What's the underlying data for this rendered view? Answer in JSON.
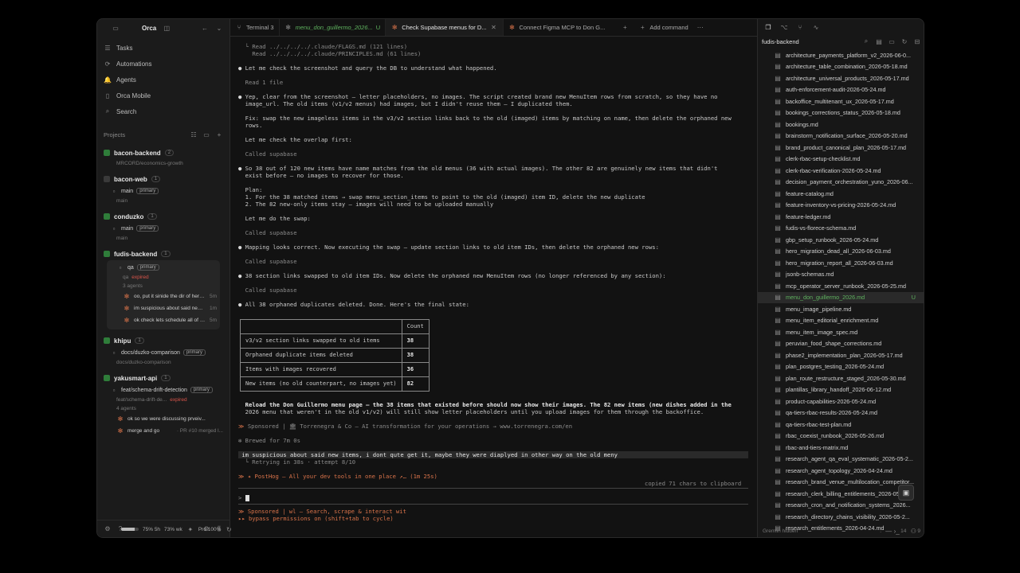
{
  "app": {
    "name": "Orca"
  },
  "nav": [
    {
      "label": "Tasks",
      "icon": "tasks-icon",
      "glyph": "☰"
    },
    {
      "label": "Automations",
      "icon": "automations-icon",
      "glyph": "⟳"
    },
    {
      "label": "Agents",
      "icon": "agents-icon",
      "glyph": "🔔"
    },
    {
      "label": "Orca Mobile",
      "icon": "mobile-icon",
      "glyph": "▯"
    },
    {
      "label": "Search",
      "icon": "search-icon",
      "glyph": "⌕"
    }
  ],
  "projects_label": "Projects",
  "projects": [
    {
      "name": "bacon-backend",
      "count": "2",
      "sub": "economics-growth",
      "path": "MRCORD/economics-growth"
    },
    {
      "name": "bacon-web",
      "count": "1",
      "branch": "main",
      "badge": "primary",
      "sub": "main"
    },
    {
      "name": "conduzko",
      "count": "1",
      "branch": "main",
      "badge": "primary",
      "sub": "main"
    },
    {
      "name": "fudis-backend",
      "count": "1",
      "branch": "qa",
      "badge": "primary",
      "sub": "qa",
      "status": "expired",
      "agents_label": "3 agents",
      "agents": [
        {
          "text": "oo, put it sinide the dir of here f...",
          "time": "5m"
        },
        {
          "text": "im suspicious about said new it...",
          "time": "1m"
        },
        {
          "text": "ok check lets schedule all of e...",
          "time": "5m"
        }
      ]
    },
    {
      "name": "khipu",
      "count": "1",
      "branch": "docs/duzko-comparison",
      "badge": "primary",
      "sub": "docs/duzko-comparison"
    },
    {
      "name": "yakusmart-api",
      "count": "1",
      "branch": "feat/schema-drift-detection",
      "badge": "primary",
      "sub": "feat/schema-drift-de...",
      "status": "expired",
      "agents_label": "4 agents",
      "agents": [
        {
          "text": "ok so we were discussing prveiv...",
          "time": ""
        },
        {
          "text": "merge and go",
          "time": "· PR #10 merged l..."
        }
      ]
    }
  ],
  "usage": {
    "five_hour": "75% 5h",
    "week": "73% wk",
    "plan": "Pro 100%",
    "five_hour_fraction": 0.75
  },
  "tabs": [
    {
      "label": "Terminal 3",
      "active": false
    },
    {
      "label": "menu_don_guillermo_2026...",
      "active": false,
      "suffix": "U"
    },
    {
      "label": "Check Supabase menus for D...",
      "active": true
    },
    {
      "label": "Connect Figma MCP to Don G...",
      "active": false
    },
    {
      "label": "Add command",
      "active": false
    }
  ],
  "terminal": {
    "read1": "Read ../../../../.claude/FLAGS.md (121 lines)",
    "read2": "Read ../../../../.claude/PRINCIPLES.md (61 lines)",
    "l1": "Let me check the screenshot and query the DB to understand what happened.",
    "l2": "Read 1 file",
    "p1a": "Yep, clear from the screenshot — letter placeholders, no images. The script created brand new MenuItem rows from scratch, so they have no",
    "p1b": "image_url. The old items (v1/v2 menus) had images, but I didn't reuse them — I duplicated them.",
    "fix1": "Fix: swap the new imageless items in the v3/v2 section links back to the old (imaged) items by matching on name, then delete the orphaned new",
    "fix2": "rows.",
    "l3": "Let me check the overlap first:",
    "called": "Called supabase",
    "p2a": "So 38 out of 120 new items have name matches from the old menus (36 with actual images). The other 82 are genuinely new items that didn't",
    "p2b": "exist before — no images to recover for those.",
    "plan": "Plan:",
    "plan1": "1. For the 38 matched items → swap menu_section_items to point to the old (imaged) item ID, delete the new duplicate",
    "plan2": "2. The 82 new-only items stay — images will need to be uploaded manually",
    "l4": "Let me do the swap:",
    "l5": "Mapping looks correct. Now executing the swap — update section links to old item IDs, then delete the orphaned new rows:",
    "l6": "38 section links swapped to old item IDs. Now delete the orphaned new MenuItem rows (no longer referenced by any section):",
    "l7": "All 38 orphaned duplicates deleted. Done. Here's the final state:",
    "reload1": "Reload the Don Guillermo menu page — the 38 items that existed before should now show their images. The 82 new items (new dishes added in the",
    "reload2": "2026 menu that weren't in the old v1/v2) will still show letter placeholders until you upload images for them through the backoffice.",
    "sponsor1": "Sponsored | 🏛 Torrenegra & Co — AI transformation for your operations → www.torrenegra.com/en",
    "brewed": "✻ Brewed for 7m 0s",
    "input_line": " im suspicious about said new items, i dont qute get it, maybe they were diaplyed in other way on the old meny",
    "retry": "  └ Retrying in 38s · attempt 8/10",
    "posthog": "PostHog — All your dev tools in one place ↗… (1m 25s)",
    "copied": "copied 71 chars to clipboard",
    "prompt": ">",
    "sponsor2": "Sponsored | wl — Search, scrape & interact wit",
    "bypass": "▸▸ bypass permissions on (shift+tab to cycle)"
  },
  "table": {
    "header": "Count",
    "rows": [
      {
        "label": "v3/v2 section links swapped to old items",
        "value": "38"
      },
      {
        "label": "Orphaned duplicate items deleted",
        "value": "38"
      },
      {
        "label": "Items with images recovered",
        "value": "36"
      },
      {
        "label": "New items (no old counterpart, no images yet)",
        "value": "82"
      }
    ]
  },
  "right": {
    "title": "fudis-backend",
    "files": [
      "architecture_payments_platform_v2_2026-06-0...",
      "architecture_table_combination_2026-05-18.md",
      "architecture_universal_products_2026-05-17.md",
      "auth-enforcement-audit-2026-05-24.md",
      "backoffice_multitenant_ux_2026-05-17.md",
      "bookings_corrections_status_2026-05-18.md",
      "bookings.md",
      "brainstorm_notification_surface_2026-05-20.md",
      "brand_product_canonical_plan_2026-05-17.md",
      "clerk-rbac-setup-checklist.md",
      "clerk-rbac-verification-2026-05-24.md",
      "decision_payment_orchestration_yuno_2026-06...",
      "feature-catalog.md",
      "feature-inventory-vs-pricing-2026-05-24.md",
      "feature-ledger.md",
      "fudis-vs-florece-schema.md",
      "gbp_setup_runbook_2026-05-24.md",
      "hero_migration_dead_all_2026-06-03.md",
      "hero_migration_report_all_2026-06-03.md",
      "jsonb-schemas.md",
      "mcp_operator_server_runbook_2026-05-25.md",
      "menu_don_guillermo_2026.md",
      "menu_image_pipeline.md",
      "menu_item_editorial_enrichment.md",
      "menu_item_image_spec.md",
      "peruvian_food_shape_corrections.md",
      "phase2_implementation_plan_2026-05-17.md",
      "plan_postgres_testing_2026-05-24.md",
      "plan_route_restructure_staged_2026-05-30.md",
      "plantillas_library_handoff_2026-06-12.md",
      "product-capabilities-2026-05-24.md",
      "qa-tiers-rbac-results-2026-05-24.md",
      "qa-tiers-rbac-test-plan.md",
      "rbac_coexist_runbook_2026-05-26.md",
      "rbac-and-tiers-matrix.md",
      "research_agent_qa_eval_systematic_2026-05-2...",
      "research_agent_topology_2026-04-24.md",
      "research_brand_venue_multilocation_competitor...",
      "research_clerk_billing_entitlements_2026-05-2...",
      "research_cron_and_notification_systems_2026...",
      "research_directory_chains_visibility_2026-05-2...",
      "research_entitlements_2026-04-24.md"
    ],
    "selected_index": 21,
    "selected_badge": "U",
    "footer_left": "Gremlin hidden",
    "footer_count1": "14",
    "footer_count2": "9"
  }
}
